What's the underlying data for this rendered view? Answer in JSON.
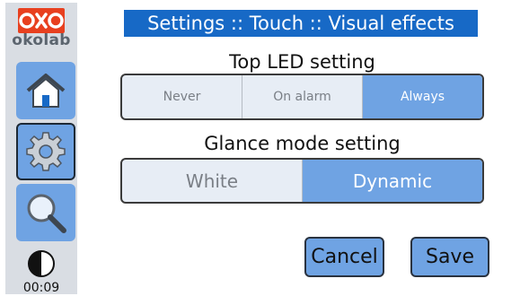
{
  "sidebar": {
    "brand": "okolab",
    "nav": [
      {
        "icon": "home-icon"
      },
      {
        "icon": "gear-icon"
      },
      {
        "icon": "magnifier-icon"
      }
    ],
    "contrast_icon": "contrast-icon",
    "clock": "00:09"
  },
  "header": {
    "title": "Settings :: Touch :: Visual effects"
  },
  "top_led": {
    "heading": "Top LED setting",
    "options": [
      "Never",
      "On alarm",
      "Always"
    ],
    "selected": "Always"
  },
  "glance_mode": {
    "heading": "Glance mode setting",
    "options": [
      "White",
      "Dynamic"
    ],
    "selected": "Dynamic"
  },
  "actions": {
    "cancel_label": "Cancel",
    "save_label": "Save"
  },
  "colors": {
    "accent": "#6fa3e3",
    "title_bar": "#1769c6",
    "sidebar_bg": "#d9dde3",
    "brand": "#e8401f"
  }
}
